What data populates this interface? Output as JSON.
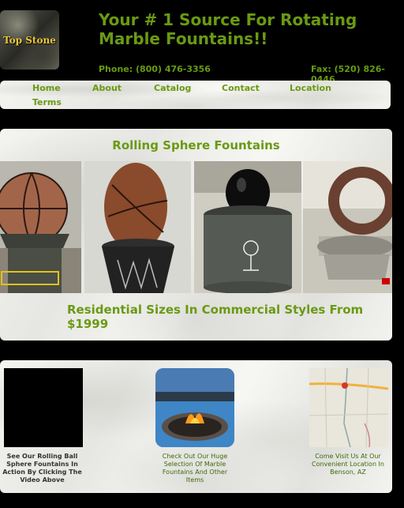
{
  "header": {
    "logo_text": "Top Stone",
    "headline": "Your # 1 Source For Rotating Marble Fountains!!",
    "phone": "Phone: (800) 476-3356",
    "fax": "Fax: (520) 826-0446"
  },
  "nav": [
    "Home",
    "About",
    "Catalog",
    "Contact",
    "Location",
    "Terms"
  ],
  "featured": {
    "title": "Rolling Sphere Fountains",
    "caption": "Residential Sizes In Commercial Styles From $1999"
  },
  "tiles": {
    "video_caption": "See Our Rolling Ball Sphere Fountains In Action By Clicking The Video Above",
    "catalog_caption": "Check Out Our Huge Selection Of Marble Fountains And Other Items",
    "location_caption": "Come Visit Us At Our Convenient Location In Benson, AZ"
  },
  "colors": {
    "accent": "#6a9a12",
    "background": "#000000"
  }
}
